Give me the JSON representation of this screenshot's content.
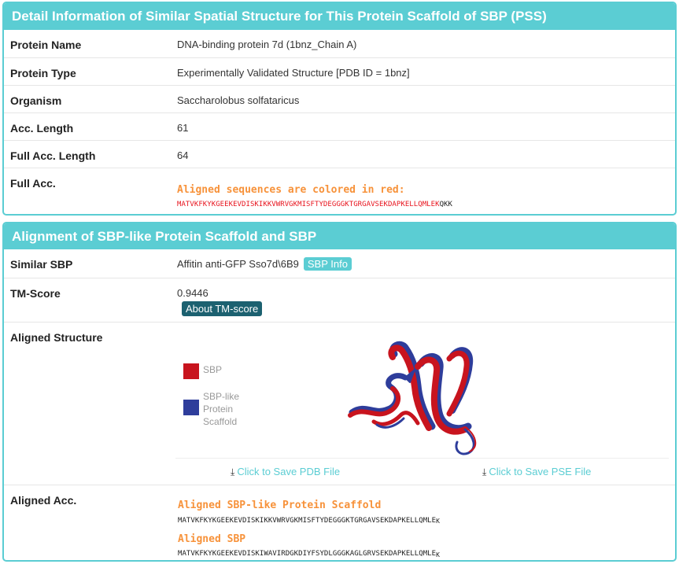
{
  "panel1": {
    "title": "Detail Information of Similar Spatial Structure for This Protein Scaffold of SBP (PSS)",
    "rows": [
      {
        "label": "Protein Name",
        "value": "DNA-binding protein 7d (1bnz_Chain A)"
      },
      {
        "label": "Protein Type",
        "value": "Experimentally Validated Structure [PDB ID = 1bnz]"
      },
      {
        "label": "Organism",
        "value": "Saccharolobus solfataricus"
      },
      {
        "label": "Acc. Length",
        "value": "61"
      },
      {
        "label": "Full Acc. Length",
        "value": "64"
      }
    ],
    "full_acc": {
      "label": "Full Acc.",
      "aligned_note": "Aligned sequences are colored in red:",
      "seq_red": "MATVKFKYKGEEKEVDISKIKKVWRVGKMISFTYDEGGGKTGRGAVSEKDAPKELLQMLEK",
      "seq_black": "QKK"
    }
  },
  "panel2": {
    "title": "Alignment of SBP-like Protein Scaffold and SBP",
    "similar_sbp": {
      "label": "Similar SBP",
      "value": "Affitin anti-GFP Sso7d\\6B9",
      "button": "SBP Info"
    },
    "tm_score": {
      "label": "TM-Score",
      "value": "0.9446",
      "button": "About TM-score"
    },
    "aligned_structure": {
      "label": "Aligned Structure",
      "legend": [
        {
          "name": "SBP",
          "color": "#c8141e"
        },
        {
          "name": "SBP-like Protein Scaffold",
          "color": "#2e3d9b"
        }
      ],
      "save_pdb": "Click to Save PDB File",
      "save_pse": "Click to Save PSE File"
    },
    "aligned_acc": {
      "label": "Aligned Acc.",
      "scaffold_title": "Aligned SBP-like Protein Scaffold",
      "scaffold_seq": "MATVKFKYKGEEKEVDISKIKKVWRVGKMISFTYDEGGGKTGRGAVSEKDAPKELLQMLE",
      "scaffold_tail": "K",
      "sbp_title": "Aligned SBP",
      "sbp_seq": "MATVKFKYKGEEKEVDISKIWAVIRDGKDIYFSYDLGGGKAGLGRVSEKDAPKELLQMLE",
      "sbp_tail": "K"
    }
  },
  "colors": {
    "accent": "#5bcdd3",
    "dark_button": "#1c6170",
    "sequence_red": "#e8141e",
    "label_orange": "#f7923a"
  },
  "icons": {
    "download": "download-icon"
  }
}
